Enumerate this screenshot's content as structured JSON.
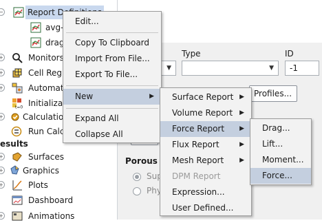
{
  "tree": {
    "items": [
      {
        "label": "Report Definitions",
        "icon": "report-definitions-icon"
      },
      {
        "label": "avg-",
        "icon": "report-item-icon"
      },
      {
        "label": "drag",
        "icon": "report-item-icon"
      },
      {
        "label": "Monitors",
        "icon": "monitors-icon"
      },
      {
        "label": "Cell Reg",
        "icon": "cell-registers-icon"
      },
      {
        "label": "Automat",
        "icon": "automation-icon"
      },
      {
        "label": "Initializat",
        "icon": "initialization-icon"
      },
      {
        "label": "Calculation",
        "icon": "calculation-icon"
      },
      {
        "label": "Run Calc",
        "icon": "run-calculation-icon"
      },
      {
        "label": "esults",
        "icon": ""
      },
      {
        "label": "Surfaces",
        "icon": "surfaces-icon"
      },
      {
        "label": "Graphics",
        "icon": "graphics-icon"
      },
      {
        "label": "Plots",
        "icon": "plots-icon"
      },
      {
        "label": "Dashboard",
        "icon": "dashboard-icon"
      },
      {
        "label": "Animations",
        "icon": "animations-icon"
      }
    ]
  },
  "panel": {
    "type_label": "Type",
    "id_label": "ID",
    "id_value": "-1",
    "profiles_button": "Profiles...",
    "porous_label": "Porous",
    "radio1_label": "Sup",
    "radio2_label": "Phy"
  },
  "context_menu": {
    "items": [
      "Edit...",
      "Copy To Clipboard",
      "Import From File...",
      "Export To File...",
      "New",
      "Expand All",
      "Collapse All"
    ]
  },
  "new_submenu": {
    "items": [
      "Surface Report",
      "Volume Report",
      "Force Report",
      "Flux Report",
      "Mesh Report",
      "DPM Report",
      "Expression...",
      "User Defined..."
    ]
  },
  "force_submenu": {
    "items": [
      "Drag...",
      "Lift...",
      "Moment...",
      "Force..."
    ]
  },
  "colors": {
    "highlight": "#c4cfdf",
    "selection": "#c9d8ee",
    "menu_bg": "#f2f2f2",
    "disabled_text": "#9b9b9b"
  }
}
